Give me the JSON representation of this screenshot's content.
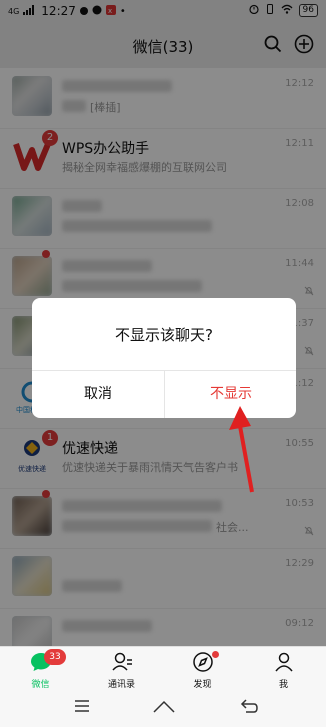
{
  "status_bar": {
    "network": "4G",
    "time": "12:27",
    "battery": "96"
  },
  "header": {
    "title": "微信(33)"
  },
  "chats": [
    {
      "name": "",
      "message": "[棒插]",
      "time": "12:12"
    },
    {
      "name": "WPS办公助手",
      "message": "揭秘全网幸福感爆棚的互联网公司",
      "time": "12:11",
      "badge": "2"
    },
    {
      "name": "",
      "message": "",
      "time": "12:08"
    },
    {
      "name": "",
      "message": "",
      "time": "11:44"
    },
    {
      "name": "",
      "message": "",
      "time": "11:37"
    },
    {
      "name": "",
      "message": "",
      "time": "11:12"
    },
    {
      "name": "优速快递",
      "message": "优速快递关于暴雨汛情天气告客户书",
      "time": "10:55",
      "badge": "1",
      "avatar_text": "优速快递"
    },
    {
      "name": "",
      "message": "社会...",
      "time": "10:53"
    },
    {
      "name": "",
      "message": "",
      "time": "12:29"
    },
    {
      "name": "",
      "message": "",
      "time": "09:12"
    }
  ],
  "dialog": {
    "title": "不显示该聊天?",
    "cancel_label": "取消",
    "confirm_label": "不显示"
  },
  "tabbar": {
    "chats": {
      "label": "微信",
      "badge": "33"
    },
    "contacts": {
      "label": "通讯录"
    },
    "discover": {
      "label": "发现"
    },
    "me": {
      "label": "我"
    }
  },
  "colors": {
    "accent": "#07c160",
    "danger": "#e53935",
    "badge": "#e33b3b"
  },
  "icons": {
    "search": "search-icon",
    "plus": "plus-circle-icon",
    "mute": "bell-off-icon",
    "chats": "chat-bubble-icon",
    "contacts": "contacts-icon",
    "discover": "compass-icon",
    "me": "person-icon",
    "menu": "menu-icon",
    "home": "home-icon",
    "back": "back-icon"
  }
}
